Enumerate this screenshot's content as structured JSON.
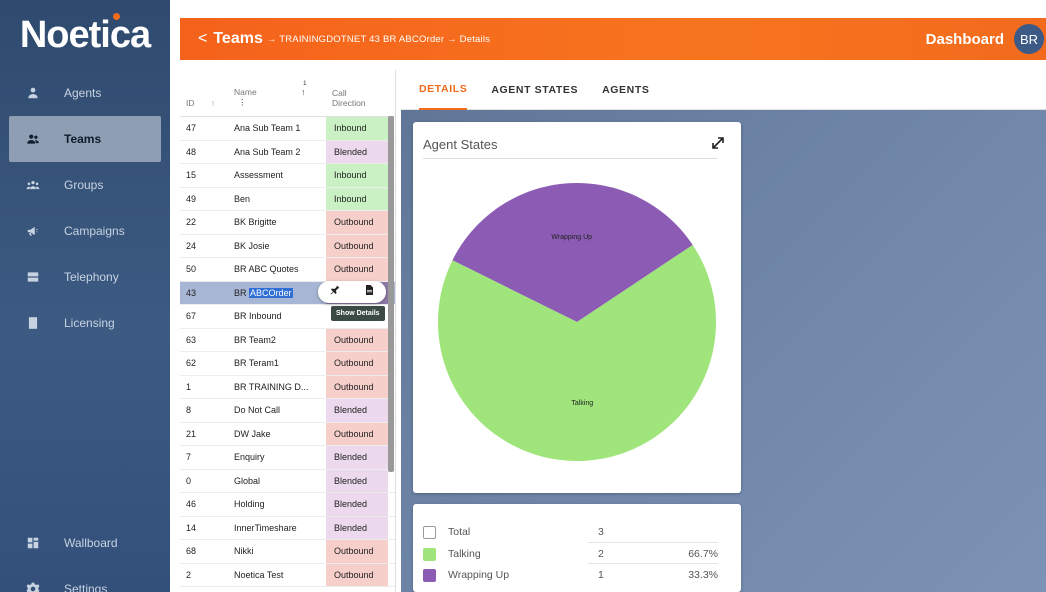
{
  "brand": {
    "name": "Noetica"
  },
  "sidebar": {
    "items": [
      {
        "label": "Agents",
        "icon": "person-icon"
      },
      {
        "label": "Teams",
        "icon": "team-icon",
        "active": true
      },
      {
        "label": "Groups",
        "icon": "groups-icon"
      },
      {
        "label": "Campaigns",
        "icon": "megaphone-icon"
      },
      {
        "label": "Telephony",
        "icon": "server-icon"
      },
      {
        "label": "Licensing",
        "icon": "license-icon"
      }
    ],
    "bottom_items": [
      {
        "label": "Wallboard",
        "icon": "wallboard-icon"
      },
      {
        "label": "Settings",
        "icon": "gear-icon"
      }
    ]
  },
  "header": {
    "back": "<",
    "teams": "Teams",
    "breadcrumb_rest": "→ TRAININGDOTNET 43 BR ABCOrder → Details",
    "dashboard": "Dashboard",
    "avatar_initials": "BR",
    "accent": "#f26b1d"
  },
  "table": {
    "headers": {
      "id": "ID",
      "name": "Name",
      "direction": "Call Direction",
      "sort_indicator": "1"
    },
    "rows": [
      {
        "id": "47",
        "name": "Ana Sub Team 1",
        "direction": "Inbound"
      },
      {
        "id": "48",
        "name": "Ana Sub Team 2",
        "direction": "Blended"
      },
      {
        "id": "15",
        "name": "Assessment",
        "direction": "Inbound"
      },
      {
        "id": "49",
        "name": "Ben",
        "direction": "Inbound"
      },
      {
        "id": "22",
        "name": "BK Brigitte",
        "direction": "Outbound"
      },
      {
        "id": "24",
        "name": "BK Josie",
        "direction": "Outbound"
      },
      {
        "id": "50",
        "name": "BR ABC Quotes",
        "direction": "Outbound"
      },
      {
        "id": "43",
        "name": "BR ",
        "name_selected": "ABCOrder",
        "direction": "",
        "selected": true
      },
      {
        "id": "67",
        "name": "BR Inbound",
        "direction": ""
      },
      {
        "id": "63",
        "name": "BR Team2",
        "direction": "Outbound"
      },
      {
        "id": "62",
        "name": "BR Teram1",
        "direction": "Outbound"
      },
      {
        "id": "1",
        "name": "BR TRAINING D...",
        "direction": "Outbound"
      },
      {
        "id": "8",
        "name": "Do Not Call",
        "direction": "Blended"
      },
      {
        "id": "21",
        "name": "DW Jake",
        "direction": "Outbound"
      },
      {
        "id": "7",
        "name": "Enquiry",
        "direction": "Blended"
      },
      {
        "id": "0",
        "name": "Global",
        "direction": "Blended"
      },
      {
        "id": "46",
        "name": "Holding",
        "direction": "Blended"
      },
      {
        "id": "14",
        "name": "InnerTimeshare",
        "direction": "Blended"
      },
      {
        "id": "68",
        "name": "Nikki",
        "direction": "Outbound"
      },
      {
        "id": "2",
        "name": "Noetica Test",
        "direction": "Outbound"
      }
    ],
    "row_actions": {
      "pin_icon": "pin-icon",
      "details_icon": "document-icon",
      "tooltip": "Show Details"
    }
  },
  "tabs": [
    {
      "label": "DETAILS",
      "active": true
    },
    {
      "label": "AGENT STATES"
    },
    {
      "label": "AGENTS"
    }
  ],
  "agent_states_card": {
    "title": "Agent States",
    "slices": [
      {
        "label": "Wrapping Up",
        "value": 1,
        "color": "#8c5bb3"
      },
      {
        "label": "Talking",
        "value": 2,
        "color": "#a0e57c"
      }
    ]
  },
  "legend": {
    "total_label": "Total",
    "total_value": "3",
    "rows": [
      {
        "label": "Talking",
        "count": "2",
        "pct": "66.7%",
        "color": "#a0e57c"
      },
      {
        "label": "Wrapping Up",
        "count": "1",
        "pct": "33.3%",
        "color": "#8c5bb3"
      }
    ]
  }
}
